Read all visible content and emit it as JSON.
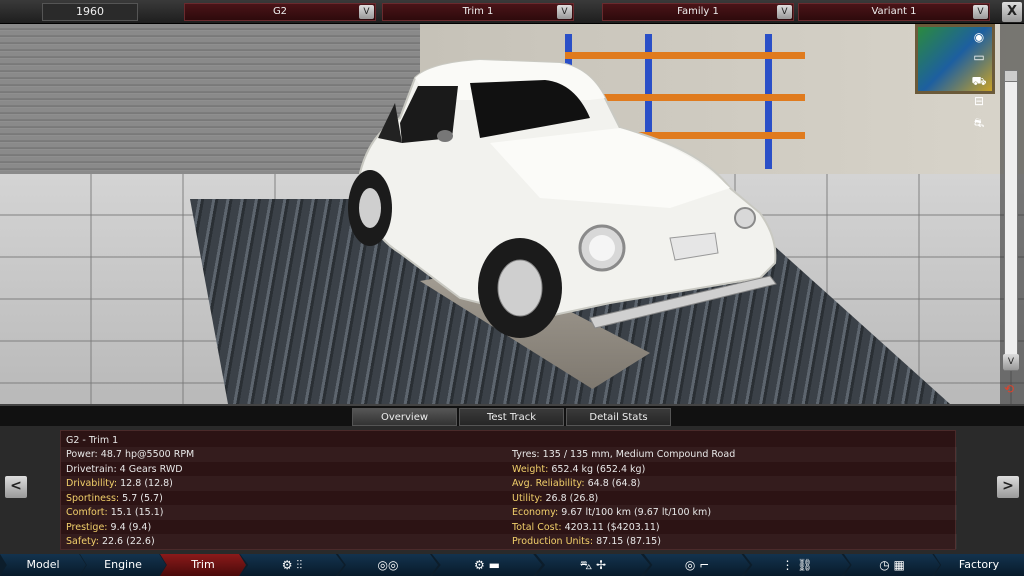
{
  "topbar": {
    "year": "1960",
    "model": "G2",
    "trim": "Trim 1",
    "family": "Family 1",
    "variant": "Variant 1",
    "dropdown_button": "V",
    "close_label": "X"
  },
  "tabs": [
    {
      "label": "Overview"
    },
    {
      "label": "Test Track"
    },
    {
      "label": "Detail Stats"
    }
  ],
  "stats": {
    "title": "G2 - Trim 1",
    "left": [
      {
        "key": "Power:",
        "value": "48.7 hp@5500 RPM",
        "highlight": false
      },
      {
        "key": "Drivetrain:",
        "value": "4 Gears RWD",
        "highlight": false
      },
      {
        "key": "Drivability:",
        "value": "12.8 (12.8)",
        "highlight": true
      },
      {
        "key": "Sportiness:",
        "value": "5.7 (5.7)",
        "highlight": true
      },
      {
        "key": "Comfort:",
        "value": "15.1 (15.1)",
        "highlight": true
      },
      {
        "key": "Prestige:",
        "value": "9.4 (9.4)",
        "highlight": true
      },
      {
        "key": "Safety:",
        "value": "22.6 (22.6)",
        "highlight": true
      }
    ],
    "right": [
      {
        "key": "Tyres:",
        "value": "135 / 135 mm, Medium Compound Road",
        "highlight": false
      },
      {
        "key": "Weight:",
        "value": "652.4 kg (652.4 kg)",
        "highlight": true
      },
      {
        "key": "Avg. Reliability:",
        "value": "64.8 (64.8)",
        "highlight": true
      },
      {
        "key": "Utility:",
        "value": "26.8 (26.8)",
        "highlight": true
      },
      {
        "key": "Economy:",
        "value": "9.67 lt/100 km (9.67 lt/100 km)",
        "highlight": true
      },
      {
        "key": "Total Cost:",
        "value": "4203.11 ($4203.11)",
        "highlight": true
      },
      {
        "key": "Production Units:",
        "value": "87.15 (87.15)",
        "highlight": true
      }
    ],
    "prev_label": "<",
    "next_label": ">"
  },
  "nav": {
    "model": "Model",
    "engine": "Engine",
    "trim": "Trim",
    "factory": "Factory"
  },
  "colors": {
    "accent_red": "#8b1a1a",
    "stat_key": "#f1cf6a",
    "nav_blue": "#13334e"
  }
}
